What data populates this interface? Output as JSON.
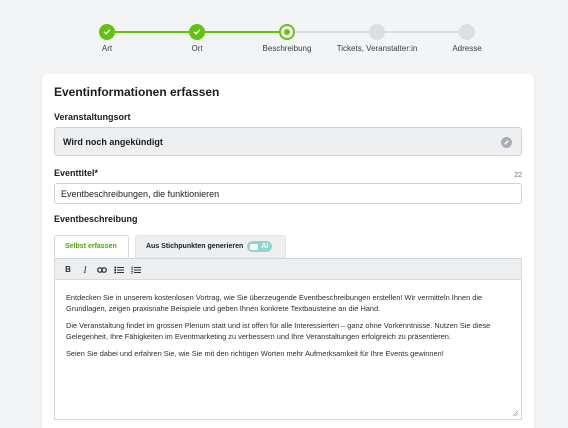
{
  "stepper": {
    "steps": [
      {
        "label": "Art",
        "state": "done"
      },
      {
        "label": "Ort",
        "state": "done"
      },
      {
        "label": "Beschreibung",
        "state": "current"
      },
      {
        "label": "Tickets, Veranstalter:in",
        "state": "todo"
      },
      {
        "label": "Adresse",
        "state": "todo"
      }
    ]
  },
  "form": {
    "title": "Eventinformationen erfassen",
    "venue": {
      "label": "Veranstaltungsort",
      "value": "Wird noch angekündigt",
      "icon": "edit-icon"
    },
    "event_title": {
      "label": "Eventtitel*",
      "value": "Eventbeschreibungen, die funktionieren",
      "counter": "22"
    },
    "description": {
      "label": "Eventbeschreibung",
      "tabs": [
        {
          "label": "Selbst erfassen",
          "active": true
        },
        {
          "label": "Aus Stichpunkten generieren",
          "active": false,
          "badge": "AI"
        }
      ],
      "toolbar": {
        "bold": "B",
        "italic": "I",
        "link_icon": "link-icon",
        "bullet_list_icon": "bullet-list-icon",
        "numbered_list_icon": "numbered-list-icon"
      },
      "paragraphs": [
        "Entdecken Sie in unserem kostenlosen Vortrag, wie Sie überzeugende Eventbeschreibungen erstellen! Wir vermitteln Ihnen die Grundlagen, zeigen praxisnahe Beispiele und geben Ihnen konkrete Textbausteine an die Hand.",
        "Die Veranstaltung findet im grossen Plenum statt und ist offen für alle Interessierten – ganz ohne Vorkenntnisse. Nutzen Sie diese Gelegenheit, Ihre Fähigkeiten im Eventmarketing zu verbessern und Ihre Veranstaltungen erfolgreich zu präsentieren.",
        "Seien Sie dabei und erfahren Sie, wie Sie mit den richtigen Worten mehr Aufmerksamkeit für Ihre Events gewinnen!"
      ]
    }
  },
  "colors": {
    "accent": "#62c20f",
    "accent_text": "#4fa50c",
    "inactive_step": "#dcdfe2",
    "ai_badge": "#8fd6d1",
    "page_bg": "#f3f4f5"
  }
}
